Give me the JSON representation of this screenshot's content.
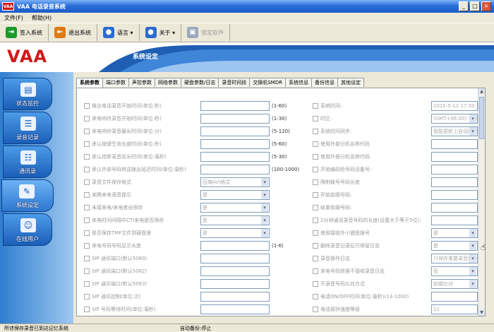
{
  "app": {
    "logo_badge": "VAA",
    "title": "VAA 电话录音系统"
  },
  "window_controls": [
    "_",
    "□",
    "×"
  ],
  "menu": [
    "文件(F)",
    "帮助(H)"
  ],
  "toolbar": {
    "buttons": [
      {
        "label": "签入系统",
        "icon": "login-icon",
        "color": "#1a9a2a",
        "glyph": "⇥"
      },
      {
        "label": "退出系统",
        "icon": "logout-icon",
        "color": "#e07a10",
        "glyph": "⇤"
      },
      {
        "label": "语言 ▾",
        "icon": "globe-language-icon",
        "color": "#2d6bd0",
        "glyph": "●"
      },
      {
        "label": "关于 ▾",
        "icon": "globe-about-icon",
        "color": "#2d6bd0",
        "glyph": "●"
      },
      {
        "label": "锁定软件",
        "icon": "lock-software-icon",
        "color": "#9aa7bd",
        "glyph": "▣",
        "dim": true
      }
    ]
  },
  "banner": {
    "brand": "VAA",
    "section_title": "系统设定"
  },
  "sidebar": {
    "items": [
      {
        "label": "状态监控",
        "icon": "status-monitor-icon",
        "glyph": "▤",
        "active": false
      },
      {
        "label": "录音记录",
        "icon": "recording-log-icon",
        "glyph": "☰",
        "active": false
      },
      {
        "label": "通讯录",
        "icon": "contacts-icon",
        "glyph": "☷",
        "active": false
      },
      {
        "label": "系统设定",
        "icon": "wrench-icon",
        "glyph": "✎",
        "active": true
      },
      {
        "label": "在线用户",
        "icon": "online-users-icon",
        "glyph": "☺",
        "active": false
      }
    ]
  },
  "tabs": [
    "系统参数",
    "端口参数",
    "声控参数",
    "网络参数",
    "硬盘参数/日志",
    "录音时间段",
    "交换机SMDR",
    "系统信息",
    "备份信息",
    "其他设定"
  ],
  "active_tab": 0,
  "left_rows": [
    {
      "label": "拨出电话录音开始时间(单位:秒)",
      "value": "",
      "range": "(1-60)",
      "type": "text"
    },
    {
      "label": "来电响铃录音开始时间(单位:秒)",
      "value": "",
      "range": "(1-30)",
      "type": "text"
    },
    {
      "label": "来电响铃录音最长时间(单位:分)",
      "value": "",
      "range": "(5-120)",
      "type": "text"
    },
    {
      "label": "承认按键生效长度时间(单位:秒)",
      "value": "",
      "range": "(5-60)",
      "type": "text"
    },
    {
      "label": "承认挂断录音延长时间(单位:毫秒)",
      "value": "",
      "range": "(5-30)",
      "type": "text"
    },
    {
      "label": "承认外部号码转送拨出延迟时间(单位:毫秒)",
      "value": "",
      "range": "(100-1000)",
      "type": "text"
    },
    {
      "label": "录音文件保存格式",
      "value": "压缩AVI格式",
      "range": "",
      "type": "select"
    },
    {
      "label": "来腾来电语音提示",
      "value": "是",
      "range": "",
      "type": "select"
    },
    {
      "label": "未接来电/来电者自保存",
      "value": "是",
      "range": "",
      "type": "select"
    },
    {
      "label": "来电时间间隔中CTI来电是否保存",
      "value": "是",
      "range": "",
      "type": "select"
    },
    {
      "label": "是否保存TMF文件到硬盘里",
      "value": "是",
      "range": "",
      "type": "select"
    },
    {
      "label": "来电号码号码显示长度",
      "value": "",
      "range": "(1-6)",
      "type": "text"
    },
    {
      "label": "SIP 通讯端口(默认5060)",
      "value": "",
      "range": "",
      "type": "text"
    },
    {
      "label": "SIP 通讯端口(默认5062)",
      "value": "",
      "range": "",
      "type": "text"
    },
    {
      "label": "SIP 通讯端口(默认5063)",
      "value": "",
      "range": "",
      "type": "text"
    },
    {
      "label": "SIP 通讯控制(单位:次)",
      "value": "",
      "range": "",
      "type": "text"
    },
    {
      "label": "SIP 号码等待时间(单位:毫秒)",
      "value": "",
      "range": "",
      "type": "text"
    },
    {
      "label": "内部号码分机号码范围",
      "value": "",
      "range": "",
      "type": "text"
    }
  ],
  "right_rows": [
    {
      "label": "系统时间:",
      "value": "2015-5-12 17:50",
      "type": "text"
    },
    {
      "label": "时区:",
      "value": "(GMT+08:00) 北京",
      "type": "select"
    },
    {
      "label": "系统时间同步:",
      "value": "智能更新上自动同步",
      "type": "select"
    },
    {
      "label": "使用外部分机名称代码",
      "value": "",
      "type": "text"
    },
    {
      "label": "使用外部分机名称代码",
      "value": "",
      "type": "text"
    },
    {
      "label": "开始编码检号码设备号:",
      "value": "",
      "type": "text"
    },
    {
      "label": "限制拨号号码长度",
      "value": "",
      "type": "text"
    },
    {
      "label": "开始前缀号码:",
      "value": "",
      "type": "text"
    },
    {
      "label": "结束前缀号码:",
      "value": "",
      "type": "text"
    },
    {
      "label": "2分钟通话录音号码的长度(设置大于等于5位):",
      "value": "",
      "type": "text"
    },
    {
      "label": "使用接收外小键盘拨号",
      "value": "是",
      "type": "select"
    },
    {
      "label": "删除录音记录后只保留日志",
      "value": "是",
      "type": "select"
    },
    {
      "label": "录音操作日志",
      "value": "只保存重要录音操作",
      "type": "select"
    },
    {
      "label": "来电号码转换不接收录音日志",
      "value": "否",
      "type": "select"
    },
    {
      "label": "不录音号码比对方式",
      "value": "前缀比对",
      "type": "select"
    },
    {
      "label": "电话ON/OFF时间(单位:毫秒)(13-1000)",
      "value": "",
      "type": "text"
    },
    {
      "label": "电话振铃强度等级",
      "value": "11",
      "type": "text"
    },
    {
      "label": "来电号码后面号码传送",
      "value": "",
      "type": "text"
    }
  ],
  "status": {
    "left": "所述保存录音已到达记忆系统",
    "middle": "自动备份:停止"
  }
}
